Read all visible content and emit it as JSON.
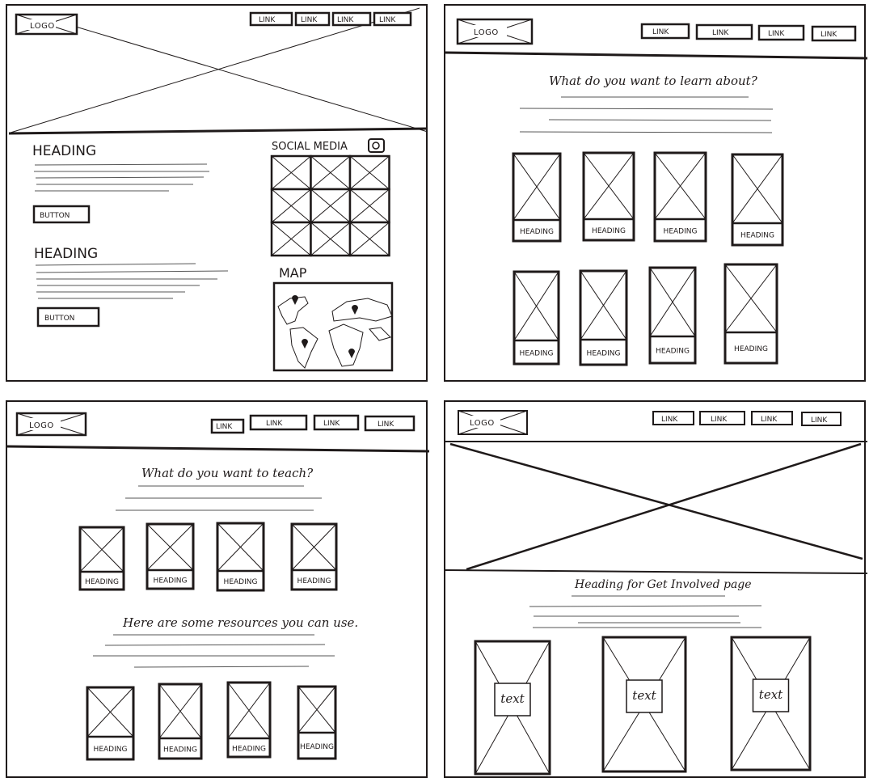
{
  "logo_text": "LOGO",
  "link_text": "LINK",
  "panel1": {
    "heading_1": "HEADING",
    "button_1": "BUTTON",
    "heading_2": "HEADING",
    "button_2": "BUTTON",
    "social_label": "SOCIAL MEDIA",
    "map_label": "MAP"
  },
  "panel2": {
    "question": "What do you want to learn about?",
    "card_heading": "HEADING"
  },
  "panel3": {
    "question": "What do you want to teach?",
    "resources": "Here are some resources you can use.",
    "card_heading": "HEADING"
  },
  "panel4": {
    "heading": "Heading for Get Involved page",
    "card_text": "text"
  }
}
